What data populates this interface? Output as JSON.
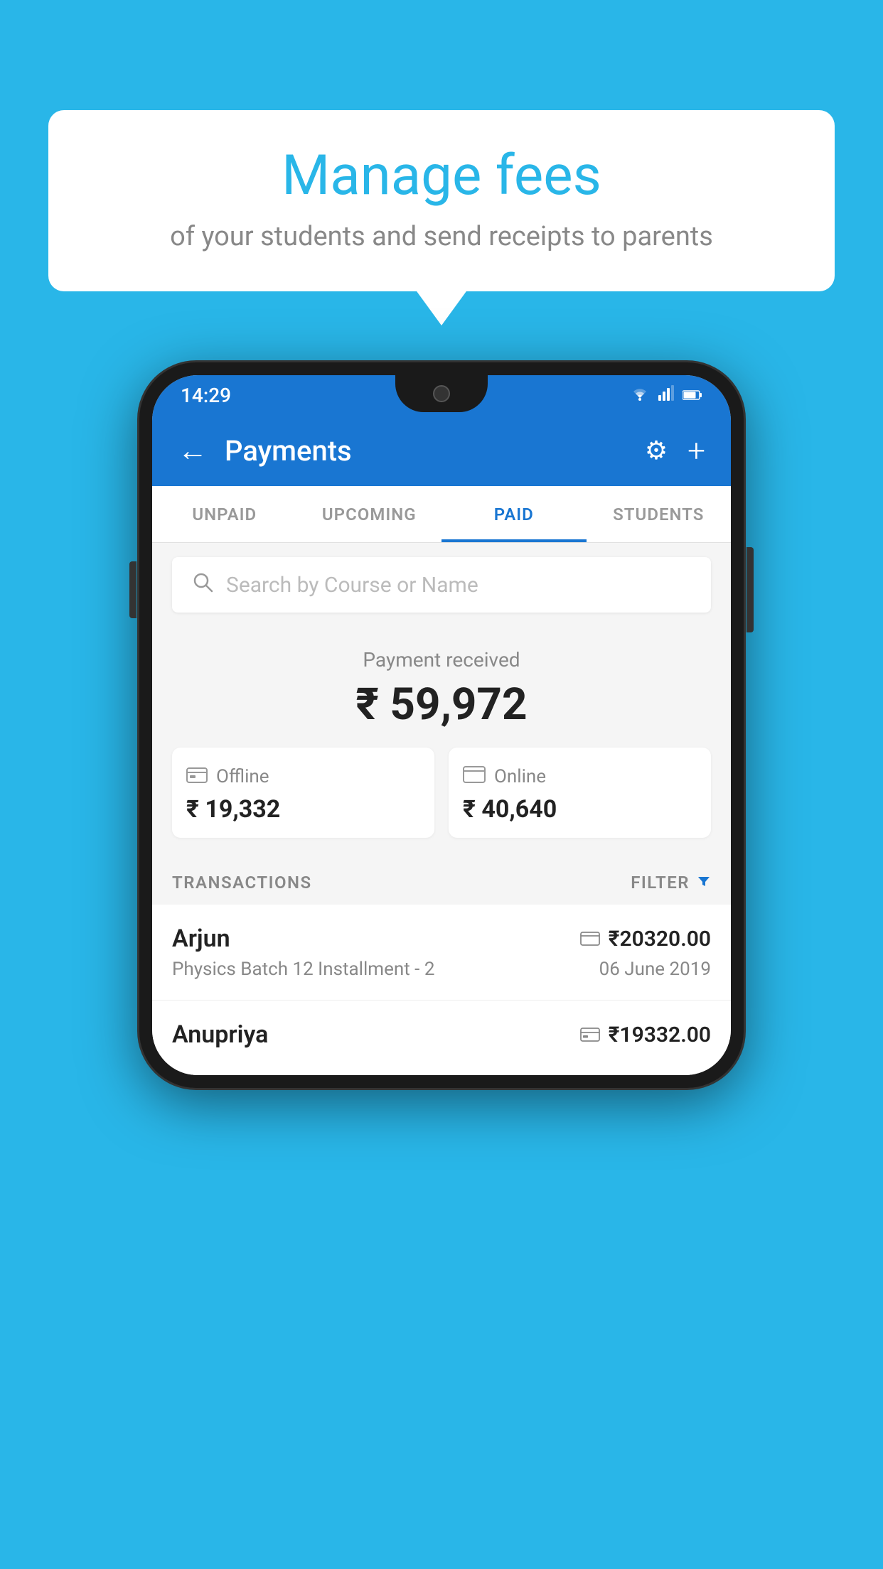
{
  "background_color": "#29b6e8",
  "bubble": {
    "title": "Manage fees",
    "subtitle": "of your students and send receipts to parents"
  },
  "status_bar": {
    "time": "14:29",
    "icons": [
      "wifi",
      "signal",
      "battery"
    ]
  },
  "app_bar": {
    "title": "Payments",
    "back_icon": "←",
    "settings_icon": "⚙",
    "add_icon": "+"
  },
  "tabs": [
    {
      "label": "UNPAID",
      "active": false
    },
    {
      "label": "UPCOMING",
      "active": false
    },
    {
      "label": "PAID",
      "active": true
    },
    {
      "label": "STUDENTS",
      "active": false
    }
  ],
  "search": {
    "placeholder": "Search by Course or Name"
  },
  "payment_summary": {
    "label": "Payment received",
    "total": "₹ 59,972",
    "offline_label": "Offline",
    "offline_amount": "₹ 19,332",
    "online_label": "Online",
    "online_amount": "₹ 40,640"
  },
  "transactions": {
    "label": "TRANSACTIONS",
    "filter_label": "FILTER",
    "rows": [
      {
        "name": "Arjun",
        "course": "Physics Batch 12 Installment - 2",
        "amount": "₹20320.00",
        "date": "06 June 2019",
        "payment_type": "online"
      },
      {
        "name": "Anupriya",
        "course": "",
        "amount": "₹19332.00",
        "date": "",
        "payment_type": "offline"
      }
    ]
  }
}
